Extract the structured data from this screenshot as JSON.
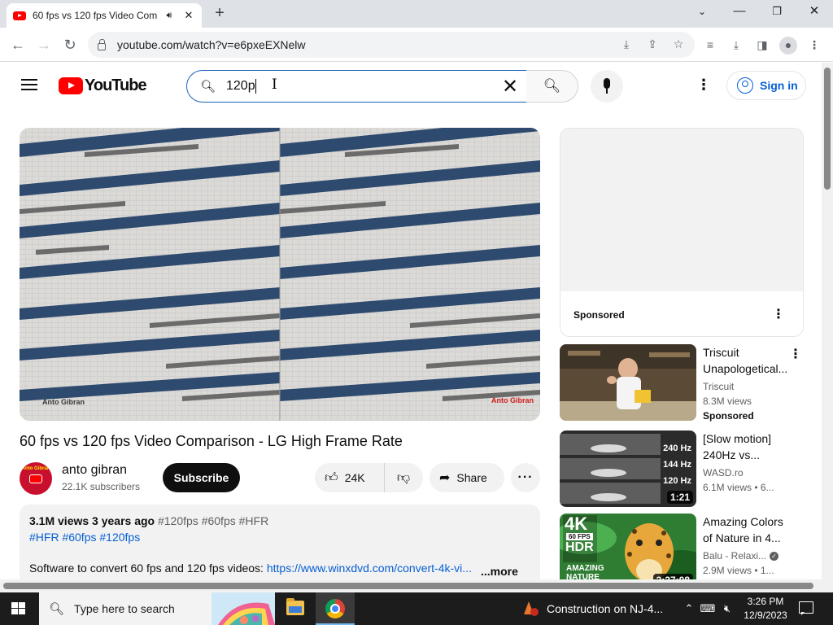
{
  "browser": {
    "tab_title": "60 fps vs 120 fps Video Com",
    "url": "youtube.com/watch?v=e6pxeEXNelw",
    "new_tab_glyph": "+",
    "tab_close_glyph": "✕"
  },
  "youtube": {
    "logo_text": "YouTube",
    "search_value": "120p",
    "sign_in_label": "Sign in"
  },
  "video": {
    "watermark_left": "Anto Gibran",
    "watermark_right": "Anto Gibran",
    "title": "60 fps vs 120 fps Video Comparison - LG High Frame Rate",
    "channel_name": "anto gibran",
    "channel_avatar_text": "Anto Gibran",
    "subscribers": "22.1K subscribers",
    "subscribe_label": "Subscribe",
    "likes": "24K",
    "share_label": "Share"
  },
  "description": {
    "views_date": "3.1M views  3 years ago",
    "tags_inline": "#120fps #60fps #HFR",
    "hashtags": "#HFR #60fps #120fps",
    "line_text": "Software to convert 60 fps and 120 fps videos: ",
    "link_text": "https://www.winxdvd.com/convert-4k-vi...",
    "more_label": "...more"
  },
  "sidebar": {
    "ad_label": "Sponsored",
    "recommendations": [
      {
        "title": "Triscuit Unapologetical...",
        "channel": "Triscuit",
        "views": "8.3M views",
        "badge": "Sponsored"
      },
      {
        "title": "[Slow motion] 240Hz vs...",
        "channel": "WASD.ro",
        "views": "6.1M views  • 6...",
        "duration": "1:21",
        "overlay": [
          "240 Hz",
          "144 Hz",
          "120 Hz"
        ]
      },
      {
        "title": "Amazing Colors of Nature in 4...",
        "channel": "Balu - Relaxi...",
        "views": "2.9M views  • 1...",
        "duration": "3:27:08",
        "overlay": [
          "4K",
          "60 FPS",
          "HDR",
          "AMAZING",
          "NATURE"
        ]
      }
    ]
  },
  "taskbar": {
    "search_placeholder": "Type here to search",
    "news_text": "Construction on NJ-4...",
    "time": "3:26 PM",
    "date": "12/9/2023"
  },
  "colors": {
    "youtube_red": "#ff0000",
    "link_blue": "#065fd4",
    "subscribe_bg": "#0f0f0f"
  }
}
